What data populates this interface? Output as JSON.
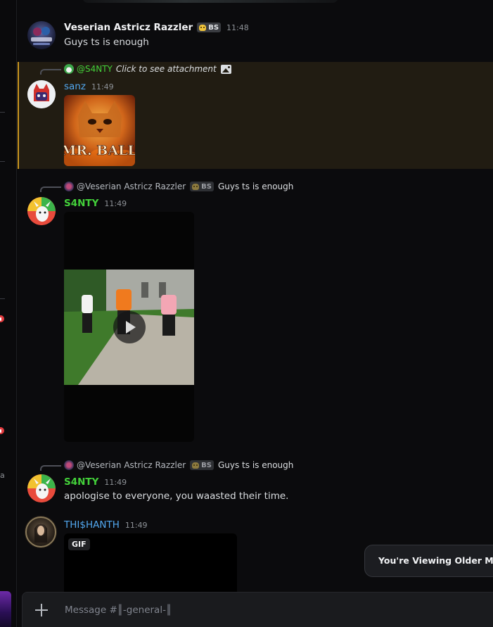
{
  "channel": {
    "name": "║-general-║"
  },
  "composer": {
    "placeholder": "Message #║-general-║"
  },
  "banner": {
    "older_messages": "You're Viewing Older Messages"
  },
  "colors": {
    "green_user": "#43d13a",
    "blue_user": "#52a8f0",
    "highlight_border": "#c89520"
  },
  "messages": [
    {
      "author": "Veserian Astricz Razzler",
      "tag": "BS",
      "time": "11:48",
      "text": "Guys ts is enough",
      "avatar_icon": "anime-clan-avatar"
    },
    {
      "reply_to": "@S4NTY",
      "reply_text": "Click to see attachment",
      "reply_icon": "image-icon",
      "author": "sanz",
      "time": "11:49",
      "attachment": "MR. BALL",
      "avatar_icon": "red-cat-avatar"
    },
    {
      "reply_to": "@Veserian Astricz Razzler",
      "reply_tag": "BS",
      "reply_text": "Guys ts is enough",
      "author": "S4NTY",
      "time": "11:49",
      "attachment_type": "video",
      "avatar_icon": "goat-avatar"
    },
    {
      "reply_to": "@Veserian Astricz Razzler",
      "reply_tag": "BS",
      "reply_text": "Guys ts is enough",
      "author": "S4NTY",
      "time": "11:49",
      "text": "apologise to everyone, you waasted their time.",
      "avatar_icon": "goat-avatar"
    },
    {
      "author": "THI$HANTH",
      "time": "11:49",
      "attachment_label": "GIF",
      "avatar_icon": "dark-portrait-avatar"
    }
  ],
  "left_rail": {
    "letter": "a"
  }
}
